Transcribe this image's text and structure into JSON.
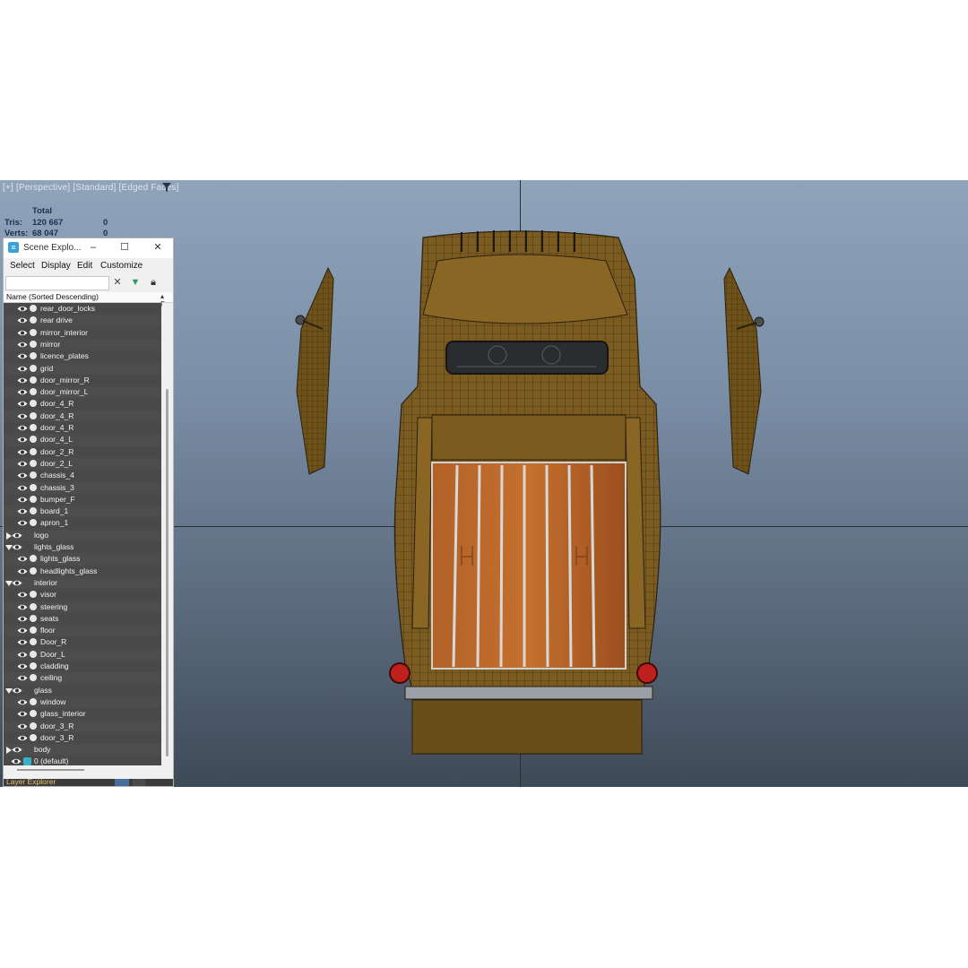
{
  "viewport": {
    "label": "[+] [Perspective] [Standard] [Edged Faces]",
    "filter_icon": "funnel-icon"
  },
  "stats": {
    "header": "Total",
    "tris_label": "Tris:",
    "tris_value": "120 667",
    "tris_extra": "0",
    "verts_label": "Verts:",
    "verts_value": "68 047",
    "verts_extra": "0"
  },
  "scene_explorer": {
    "title": "Scene Explo...",
    "menu": [
      "Select",
      "Display",
      "Edit",
      "Customize"
    ],
    "column_header": "Name (Sorted Descending)",
    "column_header_right": "▴ F...",
    "items": [
      {
        "label": "rear_door_locks",
        "type": "object"
      },
      {
        "label": "rear drive",
        "type": "object"
      },
      {
        "label": "mirror_interior",
        "type": "object"
      },
      {
        "label": "mirror",
        "type": "object"
      },
      {
        "label": "licence_plates",
        "type": "object"
      },
      {
        "label": "grid",
        "type": "object"
      },
      {
        "label": "door_mirror_R",
        "type": "object"
      },
      {
        "label": "door_mirror_L",
        "type": "object"
      },
      {
        "label": "door_4_R",
        "type": "object"
      },
      {
        "label": "door_4_R",
        "type": "object"
      },
      {
        "label": "door_4_R",
        "type": "object"
      },
      {
        "label": "door_4_L",
        "type": "object"
      },
      {
        "label": "door_2_R",
        "type": "object"
      },
      {
        "label": "door_2_L",
        "type": "object"
      },
      {
        "label": "chassis_4",
        "type": "object"
      },
      {
        "label": "chassis_3",
        "type": "object"
      },
      {
        "label": "bumper_F",
        "type": "object"
      },
      {
        "label": "board_1",
        "type": "object"
      },
      {
        "label": "apron_1",
        "type": "object"
      },
      {
        "label": "logo",
        "type": "group-collapsed"
      },
      {
        "label": "lights_glass",
        "type": "group-expanded"
      },
      {
        "label": "lights_glass",
        "type": "object"
      },
      {
        "label": "headlights_glass",
        "type": "object"
      },
      {
        "label": "interior",
        "type": "group-expanded"
      },
      {
        "label": "visor",
        "type": "object"
      },
      {
        "label": "steering",
        "type": "object"
      },
      {
        "label": "seats",
        "type": "object"
      },
      {
        "label": "floor",
        "type": "object"
      },
      {
        "label": "Door_R",
        "type": "object"
      },
      {
        "label": "Door_L",
        "type": "object"
      },
      {
        "label": "cladding",
        "type": "object"
      },
      {
        "label": "ceiling",
        "type": "object"
      },
      {
        "label": "glass",
        "type": "group-expanded"
      },
      {
        "label": "window",
        "type": "object"
      },
      {
        "label": "glass_interior",
        "type": "object"
      },
      {
        "label": "door_3_R",
        "type": "object"
      },
      {
        "label": "door_3_R",
        "type": "object"
      },
      {
        "label": "body",
        "type": "group-collapsed"
      },
      {
        "label": "0 (default)",
        "type": "layer"
      }
    ],
    "bottom_label": "Layer Explorer"
  },
  "colors": {
    "accent": "#3aa0d8",
    "tree_bg": "#494949",
    "truck_body": "#7a5a1e",
    "bed_wood": "#a85a24",
    "tail_light": "#c0201c"
  }
}
